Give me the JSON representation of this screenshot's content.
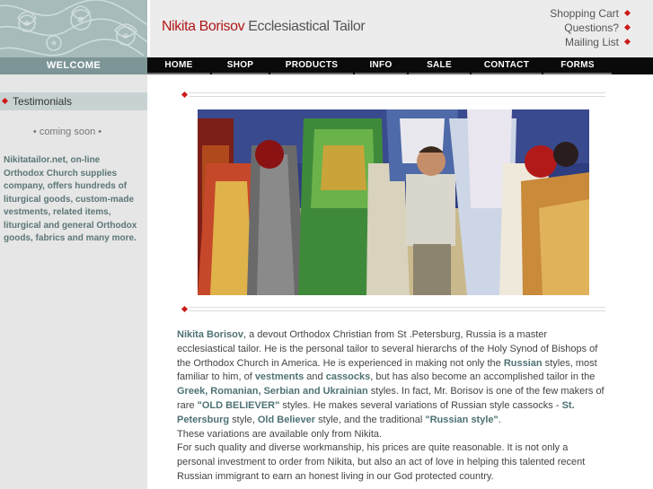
{
  "header": {
    "brand_name": "Nikita Borisov",
    "brand_subtitle": "Ecclesiastical Tailor",
    "utility_links": [
      "Shopping Cart",
      "Questions?",
      "Mailing List"
    ]
  },
  "nav": {
    "welcome": "WELCOME",
    "items": [
      "HOME",
      "SHOP",
      "PRODUCTS",
      "INFO",
      "SALE",
      "CONTACT",
      "FORMS"
    ]
  },
  "sidebar": {
    "heading": "Testimonials",
    "coming_soon": "• coming soon •",
    "description": "Nikitatailor.net, on-line Orthodox Church supplies company, offers hundreds of liturgical goods, custom-made vestments, related items, liturgical and general Orthodox goods, fabrics and many more."
  },
  "main": {
    "p1": {
      "name": "Nikita Borisov",
      "t1": ", a devout Orthodox Christian from St .Petersburg, Russia is a master ecclesiastical tailor. He is the personal tailor to several hierarchs of the Holy Synod of Bishops of the Orthodox Church in America. He is experienced in making not only the ",
      "russian": "Russian",
      "t2": " styles, most familiar to him, of ",
      "vestments": "vestments",
      "t3": " and ",
      "cassocks": "cassocks",
      "t4": ", but has also become an accomplished tailor in the ",
      "styles": "Greek, Romanian, Serbian and Ukrainian",
      "t5": " styles. In fact, Mr. Borisov is one of the few makers of rare ",
      "old_believer": "\"OLD BELIEVER\"",
      "t6": " styles. He makes several variations of Russian style cassocks - ",
      "st_petersburg": "St. Petersburg",
      "t7": " style, ",
      "old_believer2": "Old Believer",
      "t8": " style, and the traditional ",
      "russian_style": "\"Russian style\"",
      "t9": "."
    },
    "p2": "These variations are available only from Nikita.",
    "p3": "For such quality and diverse workmanship, his prices are quite reasonable. It is not only a personal investment to order from Nikita, but also an act of love in helping this talented recent Russian immigrant to earn an honest living in our God protected country."
  }
}
